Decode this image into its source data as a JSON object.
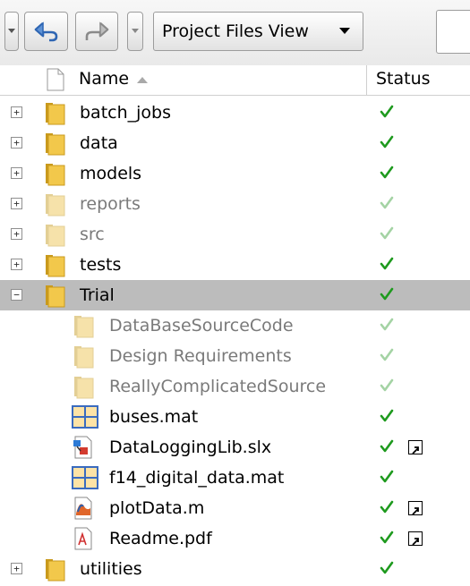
{
  "toolbar": {
    "menu_icon": "dropdown-small-icon",
    "back_icon": "undo-arrow-icon",
    "forward_icon": "redo-arrow-icon",
    "view_select": "Project Files View"
  },
  "header": {
    "name_label": "Name",
    "status_label": "Status"
  },
  "rows": [
    {
      "name": "batch_jobs",
      "type": "folder",
      "expander": "+",
      "dim": false,
      "status": "check"
    },
    {
      "name": "data",
      "type": "folder",
      "expander": "+",
      "dim": false,
      "status": "check"
    },
    {
      "name": "models",
      "type": "folder",
      "expander": "+",
      "dim": false,
      "status": "check"
    },
    {
      "name": "reports",
      "type": "folder",
      "expander": "+",
      "dim": true,
      "status": "check"
    },
    {
      "name": "src",
      "type": "folder",
      "expander": "+",
      "dim": true,
      "status": "check"
    },
    {
      "name": "tests",
      "type": "folder",
      "expander": "+",
      "dim": false,
      "status": "check"
    },
    {
      "name": "Trial",
      "type": "folder",
      "expander": "−",
      "dim": false,
      "status": "check",
      "selected": true
    },
    {
      "name": "DataBaseSourceCode",
      "type": "folder",
      "indent": true,
      "dim": true,
      "status": "check"
    },
    {
      "name": "Design Requirements",
      "type": "folder",
      "indent": true,
      "dim": true,
      "status": "check"
    },
    {
      "name": "ReallyComplicatedSource",
      "type": "folder",
      "indent": true,
      "dim": true,
      "status": "check"
    },
    {
      "name": "buses.mat",
      "type": "mat",
      "indent": true,
      "dim": false,
      "status": "check"
    },
    {
      "name": "DataLoggingLib.slx",
      "type": "slx",
      "indent": true,
      "dim": false,
      "status": "check",
      "shortcut": true
    },
    {
      "name": "f14_digital_data.mat",
      "type": "mat",
      "indent": true,
      "dim": false,
      "status": "check"
    },
    {
      "name": "plotData.m",
      "type": "m",
      "indent": true,
      "dim": false,
      "status": "check",
      "shortcut": true
    },
    {
      "name": "Readme.pdf",
      "type": "pdf",
      "indent": true,
      "dim": false,
      "status": "check",
      "shortcut": true
    },
    {
      "name": "utilities",
      "type": "folder",
      "expander": "+",
      "dim": false,
      "status": "check"
    }
  ],
  "colors": {
    "check": "#1e9a1e",
    "check_dim": "#a4d3a4",
    "folder": "#f2c84b",
    "selected_row": "#bcbcbc"
  }
}
